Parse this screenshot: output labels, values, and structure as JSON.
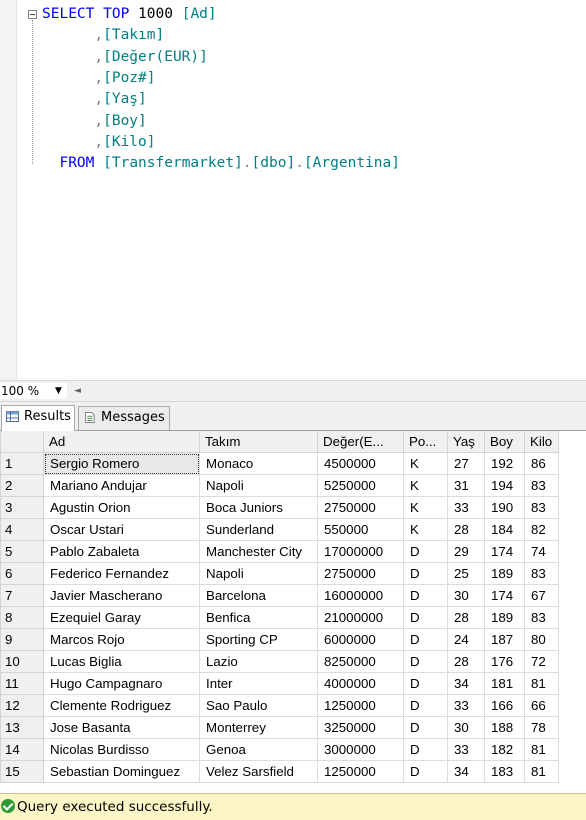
{
  "editor": {
    "lines": [
      {
        "parts": [
          {
            "t": "SELECT",
            "c": "kw"
          },
          {
            "t": " "
          },
          {
            "t": "TOP",
            "c": "kw"
          },
          {
            "t": " 1000 "
          },
          {
            "t": "[Ad]",
            "c": "id"
          }
        ]
      },
      {
        "parts": [
          {
            "t": "      ,",
            "c": "gray"
          },
          {
            "t": "[Takım]",
            "c": "id"
          }
        ]
      },
      {
        "parts": [
          {
            "t": "      ,",
            "c": "gray"
          },
          {
            "t": "[Değer(EUR)]",
            "c": "id"
          }
        ]
      },
      {
        "parts": [
          {
            "t": "      ,",
            "c": "gray"
          },
          {
            "t": "[Poz#]",
            "c": "id"
          }
        ]
      },
      {
        "parts": [
          {
            "t": "      ,",
            "c": "gray"
          },
          {
            "t": "[Yaş]",
            "c": "id"
          }
        ]
      },
      {
        "parts": [
          {
            "t": "      ,",
            "c": "gray"
          },
          {
            "t": "[Boy]",
            "c": "id"
          }
        ]
      },
      {
        "parts": [
          {
            "t": "      ,",
            "c": "gray"
          },
          {
            "t": "[Kilo]",
            "c": "id"
          }
        ]
      },
      {
        "parts": [
          {
            "t": "  FROM",
            "c": "kw"
          },
          {
            "t": " "
          },
          {
            "t": "[Transfermarket]",
            "c": "id"
          },
          {
            "t": ".",
            "c": "gray"
          },
          {
            "t": "[dbo]",
            "c": "id"
          },
          {
            "t": ".",
            "c": "gray"
          },
          {
            "t": "[Argentina]",
            "c": "id"
          }
        ]
      }
    ]
  },
  "zoom": {
    "value": "100 %"
  },
  "tabs": {
    "results": "Results",
    "messages": "Messages"
  },
  "grid": {
    "columns": [
      "Ad",
      "Takım",
      "Değer(E...",
      "Po...",
      "Yaş",
      "Boy",
      "Kilo"
    ],
    "rows": [
      [
        "1",
        "Sergio Romero",
        "Monaco",
        "4500000",
        "K",
        "27",
        "192",
        "86"
      ],
      [
        "2",
        "Mariano Andujar",
        "Napoli",
        "5250000",
        "K",
        "31",
        "194",
        "83"
      ],
      [
        "3",
        "Agustin Orion",
        "Boca Juniors",
        "2750000",
        "K",
        "33",
        "190",
        "83"
      ],
      [
        "4",
        "Oscar Ustari",
        "Sunderland",
        "550000",
        "K",
        "28",
        "184",
        "82"
      ],
      [
        "5",
        "Pablo Zabaleta",
        "Manchester City",
        "17000000",
        "D",
        "29",
        "174",
        "74"
      ],
      [
        "6",
        "Federico Fernandez",
        "Napoli",
        "2750000",
        "D",
        "25",
        "189",
        "83"
      ],
      [
        "7",
        "Javier Mascherano",
        "Barcelona",
        "16000000",
        "D",
        "30",
        "174",
        "67"
      ],
      [
        "8",
        "Ezequiel Garay",
        "Benfica",
        "21000000",
        "D",
        "28",
        "189",
        "83"
      ],
      [
        "9",
        "Marcos Rojo",
        "Sporting CP",
        "6000000",
        "D",
        "24",
        "187",
        "80"
      ],
      [
        "10",
        "Lucas Biglia",
        "Lazio",
        "8250000",
        "D",
        "28",
        "176",
        "72"
      ],
      [
        "11",
        "Hugo Campagnaro",
        "Inter",
        "4000000",
        "D",
        "34",
        "181",
        "81"
      ],
      [
        "12",
        "Clemente Rodriguez",
        "Sao Paulo",
        "1250000",
        "D",
        "33",
        "166",
        "66"
      ],
      [
        "13",
        "Jose Basanta",
        "Monterrey",
        "3250000",
        "D",
        "30",
        "188",
        "78"
      ],
      [
        "14",
        "Nicolas Burdisso",
        "Genoa",
        "3000000",
        "D",
        "33",
        "182",
        "81"
      ],
      [
        "15",
        "Sebastian Dominguez",
        "Velez Sarsfield",
        "1250000",
        "D",
        "34",
        "183",
        "81"
      ]
    ]
  },
  "status": {
    "text": "Query executed successfully."
  },
  "colors": {
    "keyword": "#0000ff",
    "identifier": "#008080",
    "status_bg": "#fcf5c5",
    "success": "#2e9a35"
  }
}
